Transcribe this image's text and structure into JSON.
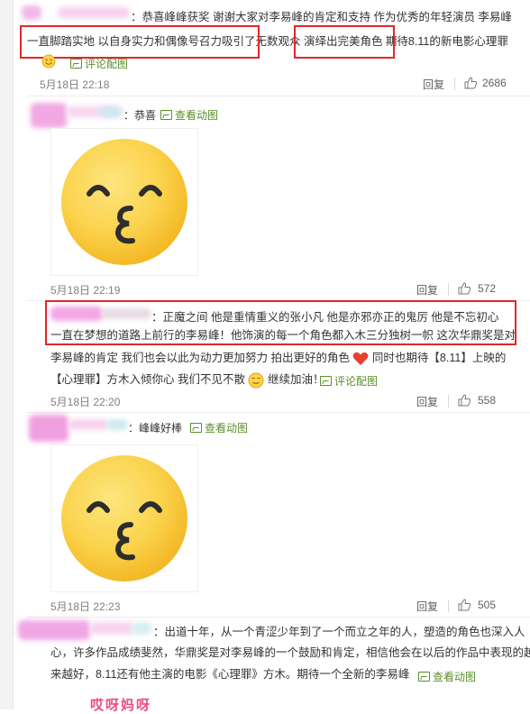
{
  "comments": [
    {
      "line1": "：恭喜峰峰获奖  谢谢大家对李易峰的肯定和支持 作为优秀的年轻演员 李易峰",
      "line2": "一直脚踏实地 以自身实力和偶像号召力吸引了无数观众 演绎出完美角色 期待8.11的新电影心理罪",
      "link": "评论配图",
      "time": "5月18日 22:18",
      "reply": "回复",
      "likes": "2686"
    },
    {
      "text": "：恭喜",
      "link": "查看动图",
      "time": "5月18日 22:19",
      "reply": "回复",
      "likes": "572"
    },
    {
      "line1": "：正魔之间 他是重情重义的张小凡 他是亦邪亦正的鬼厉 他是不忘初心",
      "line2": "一直在梦想的道路上前行的李易峰！他饰演的每一个角色都入木三分独树一帜 这次华鼎奖是对",
      "line3": "李易峰的肯定 我们也会以此为动力更加努力 拍出更好的角色",
      "line3b": "同时也期待【8.11】上映的",
      "line4": "【心理罪】方木入倾你心 我们不见不散",
      "line4b": "继续加油！",
      "link": "评论配图",
      "time": "5月18日 22:20",
      "reply": "回复",
      "likes": "558"
    },
    {
      "text": "：峰峰好棒",
      "link": "查看动图",
      "time": "5月18日 22:23",
      "reply": "回复",
      "likes": "505"
    },
    {
      "line1": "：出道十年，从一个青涩少年到了一个而立之年的人，塑造的角色也深入人",
      "line2": "心，许多作品成绩斐然，华鼎奖是对李易峰的一个鼓励和肯定，相信他会在以后的作品中表现的越",
      "line3": "来越好，8.11还有他主演的电影《心理罪》方木。期待一个全新的李易峰",
      "link": "查看动图",
      "sign": "哎呀妈呀"
    }
  ],
  "colors": {
    "highlight_box": "#e0262b",
    "link": "#5a8f2a",
    "meta": "#808080"
  },
  "icons": [
    "thumbs-up-icon",
    "image-icon",
    "kiss-emoji-icon",
    "heart-icon",
    "smile-emoji-icon"
  ]
}
